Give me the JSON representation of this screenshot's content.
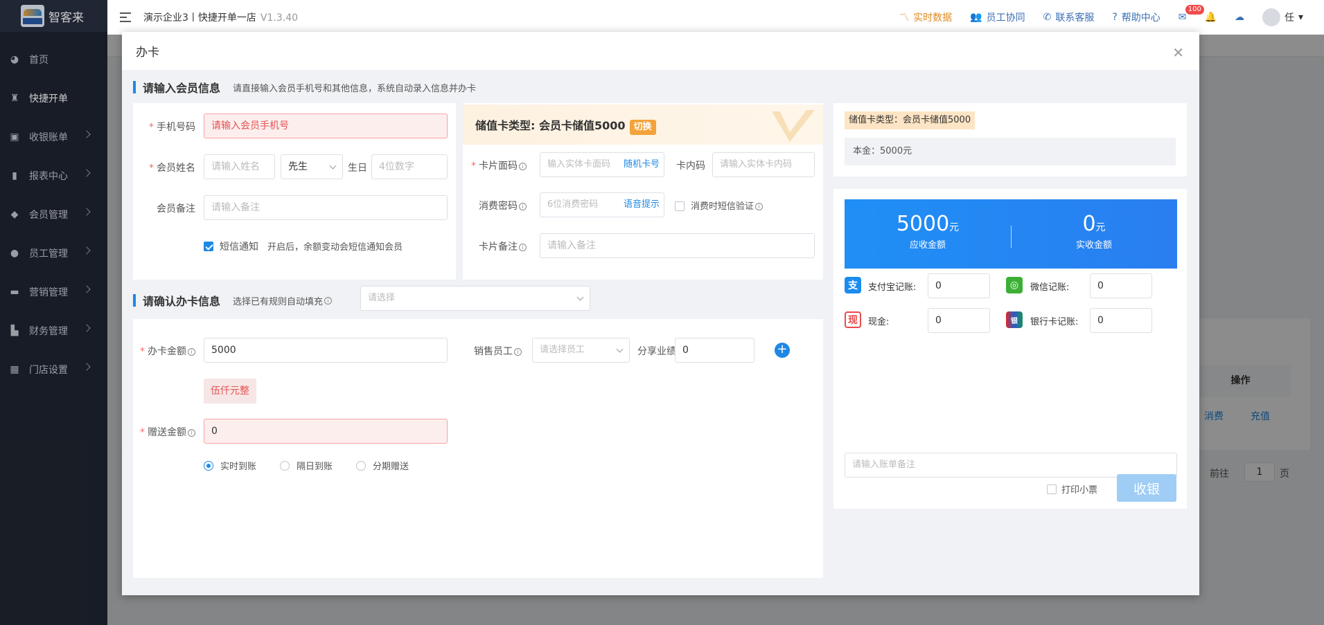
{
  "app": {
    "logo_text": "智客来",
    "logo_small": "智客来"
  },
  "header": {
    "title": "演示企业3丨快捷开单一店",
    "version": "V1.3.40",
    "items": [
      {
        "label": "实时数据"
      },
      {
        "label": "员工协同"
      },
      {
        "label": "联系客服"
      },
      {
        "label": "帮助中心"
      }
    ],
    "mail_badge": "100",
    "user": "任"
  },
  "sidebar": {
    "items": [
      {
        "label": "首页"
      },
      {
        "label": "快捷开单"
      },
      {
        "label": "收银账单"
      },
      {
        "label": "报表中心"
      },
      {
        "label": "会员管理"
      },
      {
        "label": "员工管理"
      },
      {
        "label": "营销管理"
      },
      {
        "label": "财务管理"
      },
      {
        "label": "门店设置"
      }
    ]
  },
  "background": {
    "col_action": "操作",
    "consume": "消费",
    "recharge": "充值",
    "goto": "前往",
    "page_value": "1",
    "page_unit": "页"
  },
  "modal": {
    "title": "办卡",
    "member_section": {
      "title": "请输入会员信息",
      "tip": "请直接输入会员手机号和其他信息，系统自动录入信息并办卡"
    },
    "phone": {
      "label": "手机号码",
      "placeholder": "请输入会员手机号"
    },
    "name": {
      "label": "会员姓名",
      "placeholder": "请输入姓名",
      "gender": "先生",
      "birthday_label": "生日",
      "birthday_placeholder": "4位数字"
    },
    "remark": {
      "label": "会员备注",
      "placeholder": "请输入备注"
    },
    "sms": {
      "label": "短信通知",
      "tip": "开启后，余额变动会短信通知会员"
    },
    "card_type": {
      "prefix": "储值卡类型: 会员卡储值5000",
      "switch": "切换"
    },
    "card_face": {
      "label": "卡片面码",
      "placeholder": "输入实体卡面码",
      "random": "随机卡号",
      "inner_label": "卡内码",
      "inner_placeholder": "请输入实体卡内码"
    },
    "pwd": {
      "label": "消费密码",
      "placeholder": "6位消费密码",
      "voice": "语音提示",
      "sms_verify": "消费时短信验证"
    },
    "card_remark": {
      "label": "卡片备注",
      "placeholder": "请输入备注"
    },
    "confirm_section": {
      "title": "请确认办卡信息",
      "rule_label": "选择已有规则自动填充",
      "rule_placeholder": "请选择"
    },
    "amount": {
      "label": "办卡金额",
      "value": "5000",
      "upper": "伍仟元整"
    },
    "staff": {
      "label": "销售员工",
      "placeholder": "请选择员工",
      "share_label": "分享业绩",
      "share_value": "0"
    },
    "gift": {
      "label": "赠送金额",
      "value": "0"
    },
    "arrival": {
      "options": [
        "实时到账",
        "隔日到账",
        "分期赠送"
      ]
    },
    "summary": {
      "type_tag": "储值卡类型：会员卡储值5000",
      "principal": "本金：5000元"
    },
    "receivable": {
      "value": "5000",
      "unit": "元",
      "caption": "应收金额"
    },
    "received": {
      "value": "0",
      "unit": "元",
      "caption": "实收金额"
    },
    "payments": [
      {
        "label": "支付宝记账:",
        "value": "0"
      },
      {
        "label": "微信记账:",
        "value": "0"
      },
      {
        "label": "现金:",
        "value": "0"
      },
      {
        "label": "银行卡记账:",
        "value": "0"
      }
    ],
    "bill_remark_placeholder": "请输入账单备注",
    "print": "打印小票",
    "checkout": "收银"
  }
}
